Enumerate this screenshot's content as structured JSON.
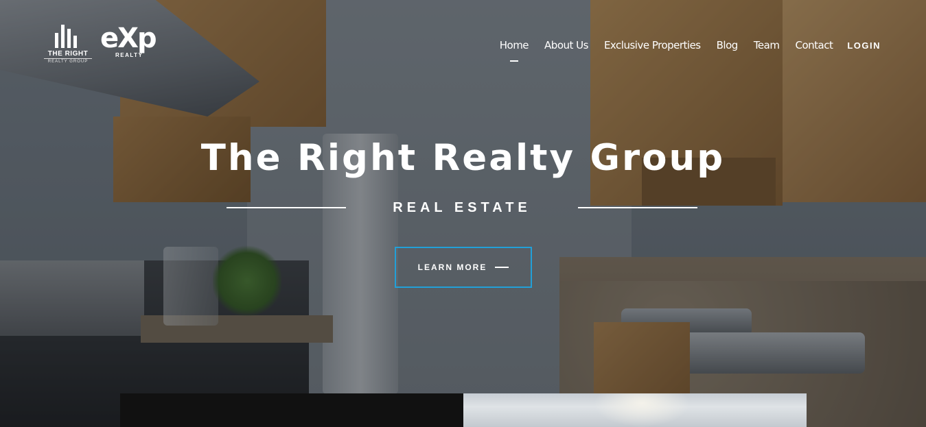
{
  "header": {
    "logo_primary": {
      "name": "THE RIGHT",
      "sub": "REALTY GROUP"
    },
    "logo_secondary": {
      "word": "eXp",
      "sub": "REALTY"
    },
    "nav": [
      {
        "label": "Home",
        "active": true
      },
      {
        "label": "About Us",
        "active": false
      },
      {
        "label": "Exclusive Properties",
        "active": false
      },
      {
        "label": "Blog",
        "active": false
      },
      {
        "label": "Team",
        "active": false
      },
      {
        "label": "Contact",
        "active": false
      }
    ],
    "login_label": "LOGIN"
  },
  "hero": {
    "title": "The Right Realty Group",
    "tagline": "REAL ESTATE",
    "cta_label": "LEARN MORE",
    "cta_border_color": "#22a0d8"
  }
}
